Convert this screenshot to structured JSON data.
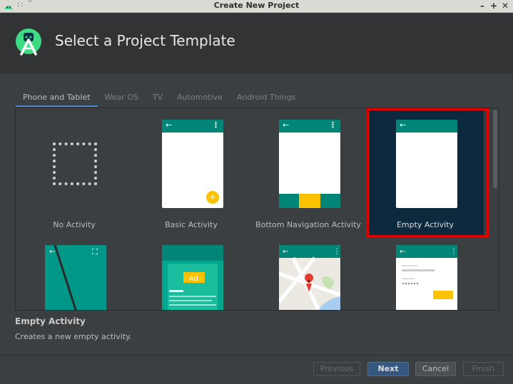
{
  "window": {
    "title": "Create New Project",
    "title_dots": ":: ‾",
    "controls": {
      "minimize": "–",
      "maximize": "+",
      "close": "✕"
    }
  },
  "header": {
    "title": "Select a Project Template"
  },
  "tabs": [
    {
      "label": "Phone and Tablet",
      "active": true
    },
    {
      "label": "Wear OS"
    },
    {
      "label": "TV"
    },
    {
      "label": "Automotive"
    },
    {
      "label": "Android Things"
    }
  ],
  "templates": [
    {
      "label": "No Activity"
    },
    {
      "label": "Basic Activity"
    },
    {
      "label": "Bottom Navigation Activity"
    },
    {
      "label": "Empty Activity",
      "selected": true
    }
  ],
  "preview_glyphs": {
    "back": "←",
    "more": "⋮",
    "fab": "+",
    "fullscreen": "⛶",
    "ad": "Ad"
  },
  "description": {
    "title": "Empty Activity",
    "text": "Creates a new empty activity."
  },
  "buttons": {
    "previous": "Previous",
    "next": "Next",
    "cancel": "Cancel",
    "finish": "Finish"
  },
  "colors": {
    "accent_teal": "#008577",
    "accent_yellow": "#fbc200",
    "selection": "#0d293e",
    "highlight_outline": "#e00000",
    "primary_button": "#365880"
  }
}
